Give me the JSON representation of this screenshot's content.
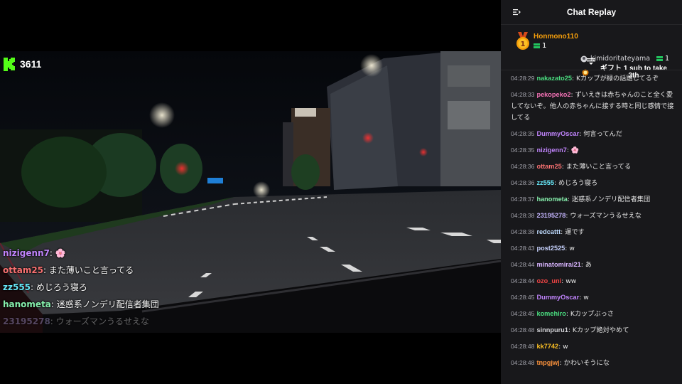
{
  "player": {
    "viewer_count": "3611",
    "overlay_messages": [
      {
        "user": "nizigenn7",
        "color": "#c084fc",
        "text": "🌸",
        "fade": false
      },
      {
        "user": "ottam25",
        "color": "#f87171",
        "text": "また薄いこと言ってる",
        "fade": false
      },
      {
        "user": "zz555",
        "color": "#67e8f9",
        "text": "めじろう寝ろ",
        "fade": false
      },
      {
        "user": "hanometa",
        "color": "#86efac",
        "text": "迷惑系ノンデリ配信者集団",
        "fade": false
      },
      {
        "user": "23195278",
        "color": "#c4b5fd",
        "text": "ウォーズマンうるせえな",
        "fade": true
      }
    ]
  },
  "chat": {
    "title": "Chat Replay",
    "pinned": {
      "top_gifter": "Honmono110",
      "top_gifter_count": "1",
      "gift_user": "kimidoritateyama",
      "gift_user_count": "1",
      "gift_text": "ギフト 1 sub to take 3th"
    },
    "messages": [
      {
        "time": "04:28:29",
        "user": "nakazato25",
        "color": "#4ade80",
        "text": "Kカップが緑の話題してるぞ"
      },
      {
        "time": "04:28:33",
        "user": "pekopeko2",
        "color": "#f472b6",
        "text": "ずいえきは赤ちゃんのこと全く愛してないぞ。他人の赤ちゃんに接する時と同じ感情で接してる"
      },
      {
        "time": "04:28:35",
        "user": "DummyOscar",
        "color": "#c084fc",
        "text": "何言ってんだ"
      },
      {
        "time": "04:28:35",
        "user": "nizigenn7",
        "color": "#c084fc",
        "text": "🌸"
      },
      {
        "time": "04:28:36",
        "user": "ottam25",
        "color": "#f87171",
        "text": "また薄いこと言ってる"
      },
      {
        "time": "04:28:36",
        "user": "zz555",
        "color": "#67e8f9",
        "text": "めじろう寝ろ"
      },
      {
        "time": "04:28:37",
        "user": "hanometa",
        "color": "#86efac",
        "text": "迷惑系ノンデリ配信者集団"
      },
      {
        "time": "04:28:38",
        "user": "23195278",
        "color": "#c4b5fd",
        "text": "ウォーズマンうるせえな"
      },
      {
        "time": "04:28:38",
        "user": "redcattt",
        "color": "#bfdbfe",
        "text": "運です"
      },
      {
        "time": "04:28:43",
        "user": "post2525",
        "color": "#c7d2fe",
        "text": "w"
      },
      {
        "time": "04:28:44",
        "user": "minatomirai21",
        "color": "#d8b4fe",
        "text": "あ"
      },
      {
        "time": "04:28:44",
        "user": "ozo_uni",
        "color": "#ef4444",
        "text": "ww"
      },
      {
        "time": "04:28:45",
        "user": "DummyOscar",
        "color": "#c084fc",
        "text": "w"
      },
      {
        "time": "04:28:45",
        "user": "komehiro",
        "color": "#4ade80",
        "text": "Kカップぶっさ"
      },
      {
        "time": "04:28:48",
        "user": "sinnpuru1",
        "color": "#d4d4d8",
        "text": "Kカップ絶対やめて"
      },
      {
        "time": "04:28:48",
        "user": "kk7742",
        "color": "#fbbf24",
        "text": "w"
      },
      {
        "time": "04:28:48",
        "user": "tnpgjwj",
        "color": "#fb923c",
        "text": "かわいそうにな"
      }
    ]
  }
}
